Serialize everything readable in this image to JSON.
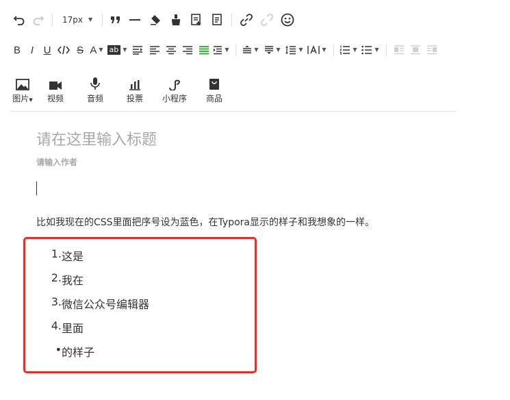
{
  "toolbar": {
    "font_size": "17px",
    "marker_text": "ab"
  },
  "media": {
    "items": [
      {
        "label": "图片",
        "icon": "image-icon"
      },
      {
        "label": "视频",
        "icon": "video-icon"
      },
      {
        "label": "音频",
        "icon": "microphone-icon"
      },
      {
        "label": "投票",
        "icon": "vote-chart-icon"
      },
      {
        "label": "小程序",
        "icon": "mini-program-icon"
      },
      {
        "label": "商品",
        "icon": "shopping-bag-icon"
      }
    ]
  },
  "editor": {
    "title_placeholder": "请在这里输入标题",
    "author_placeholder": "请输入作者",
    "paragraph": "比如我现在的CSS里面把序号设为蓝色，在Typora显示的样子和我想象的一样。",
    "list": [
      {
        "marker": "1.",
        "text": "这是"
      },
      {
        "marker": "2.",
        "text": "我在"
      },
      {
        "marker": "3.",
        "text": "微信公众号编辑器"
      },
      {
        "marker": "4.",
        "text": "里面"
      },
      {
        "marker": "•",
        "text": "的样子"
      }
    ]
  },
  "colors": {
    "highlight_box": "#e3302b",
    "justify_active": "#1aad19",
    "placeholder": "#a8a8a8"
  }
}
